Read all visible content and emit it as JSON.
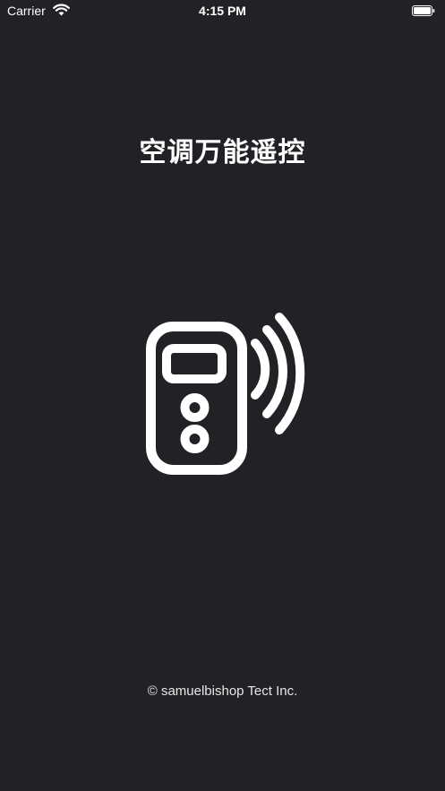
{
  "status_bar": {
    "carrier": "Carrier",
    "time": "4:15 PM"
  },
  "app": {
    "title": "空调万能遥控",
    "logo_icon": "remote-control-signal-icon"
  },
  "footer": {
    "copyright": "© samuelbishop Tect Inc."
  },
  "colors": {
    "background": "#222226",
    "foreground": "#ffffff"
  }
}
